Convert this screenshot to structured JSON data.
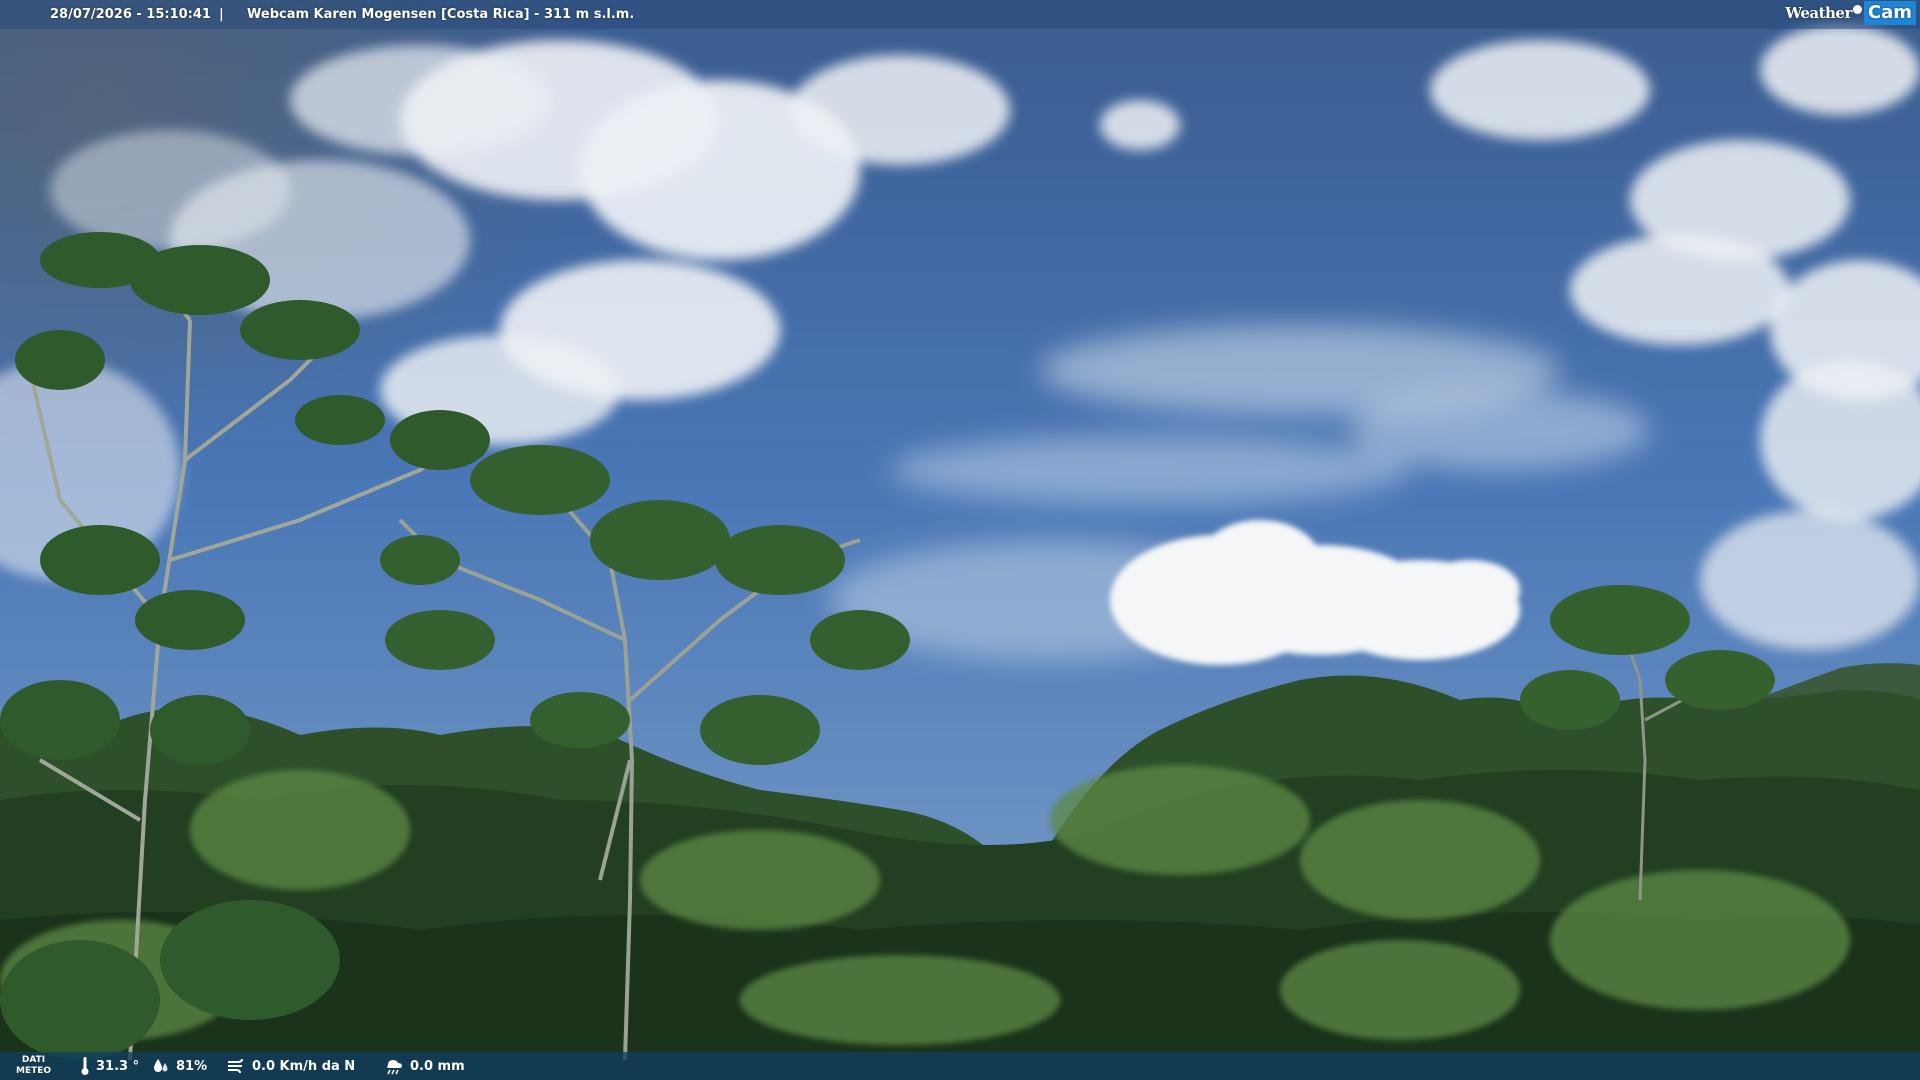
{
  "overlay": {
    "timestamp": "28/07/2026 - 15:10:41",
    "separator": "|",
    "camera_title": "Webcam Karen Mogensen [Costa Rica]  - 311 m s.l.m.",
    "brand_weather": "Weather",
    "brand_cam": "Cam"
  },
  "weather": {
    "label_line1": "DATI",
    "label_line2": "METEO",
    "temperature": "31.3 °",
    "humidity": "81%",
    "wind": "0.0 Km/h da N",
    "rain": "0.0 mm"
  },
  "colors": {
    "sky_top": "#3d5f93",
    "sky_mid": "#4a78b8",
    "sky_bottom": "#6e94c4",
    "cloud": "#f2f4f7",
    "foliage_dark": "#17301a",
    "foliage_mid": "#2f5a2a",
    "foliage_light": "#5e8c48",
    "accent": "#1f86d6"
  },
  "icons": {
    "thermometer": "thermometer-icon",
    "humidity": "humidity-drop-icon",
    "wind": "wind-icon",
    "rain": "rain-icon"
  }
}
